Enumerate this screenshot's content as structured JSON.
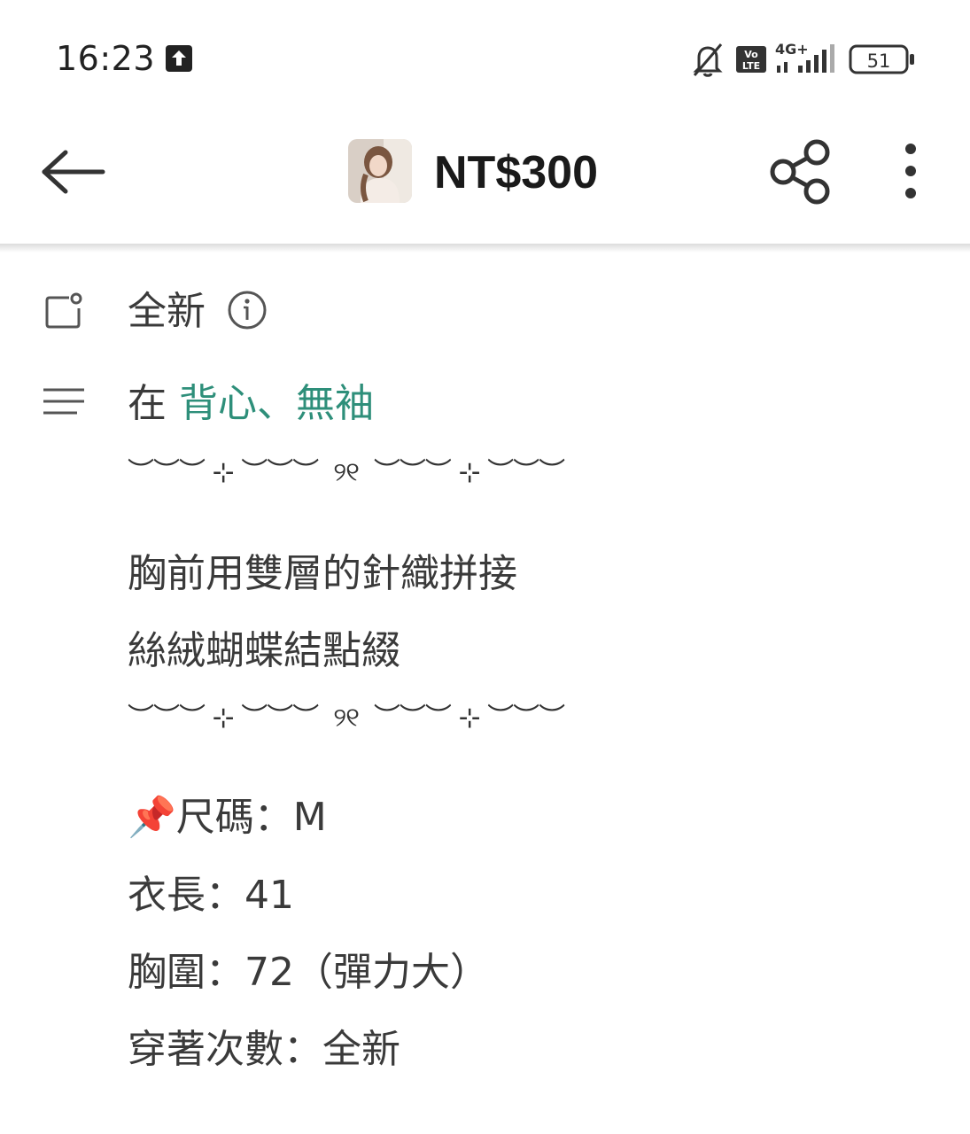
{
  "status_bar": {
    "time": "16:23",
    "network": "4G+",
    "volte": "Vo LTE",
    "battery": "51",
    "icons": [
      "upload-icon",
      "bell-muted-icon",
      "volte-icon",
      "signal-icon",
      "battery-icon"
    ]
  },
  "header": {
    "price": "NT$300",
    "icons": [
      "back-arrow-icon",
      "product-thumbnail",
      "share-icon",
      "more-vertical-icon"
    ]
  },
  "condition": {
    "label": "全新",
    "icon": "info-icon"
  },
  "category": {
    "prefix": "在 ",
    "link": "背心、無袖"
  },
  "description": {
    "decoration": "︶︶︶ ⊹ ︶︶︶  ୨୧  ︶︶︶ ⊹ ︶︶︶",
    "line1": "胸前用雙層的針織拼接",
    "line2": "絲絨蝴蝶結點綴",
    "size": "📌尺碼：M",
    "length": "衣長：41",
    "chest": "胸圍：72（彈力大）",
    "wear_count": "穿著次數：全新"
  },
  "colors": {
    "accent": "#2e8f7a",
    "text": "#3a3a3a",
    "icon": "#555555"
  }
}
